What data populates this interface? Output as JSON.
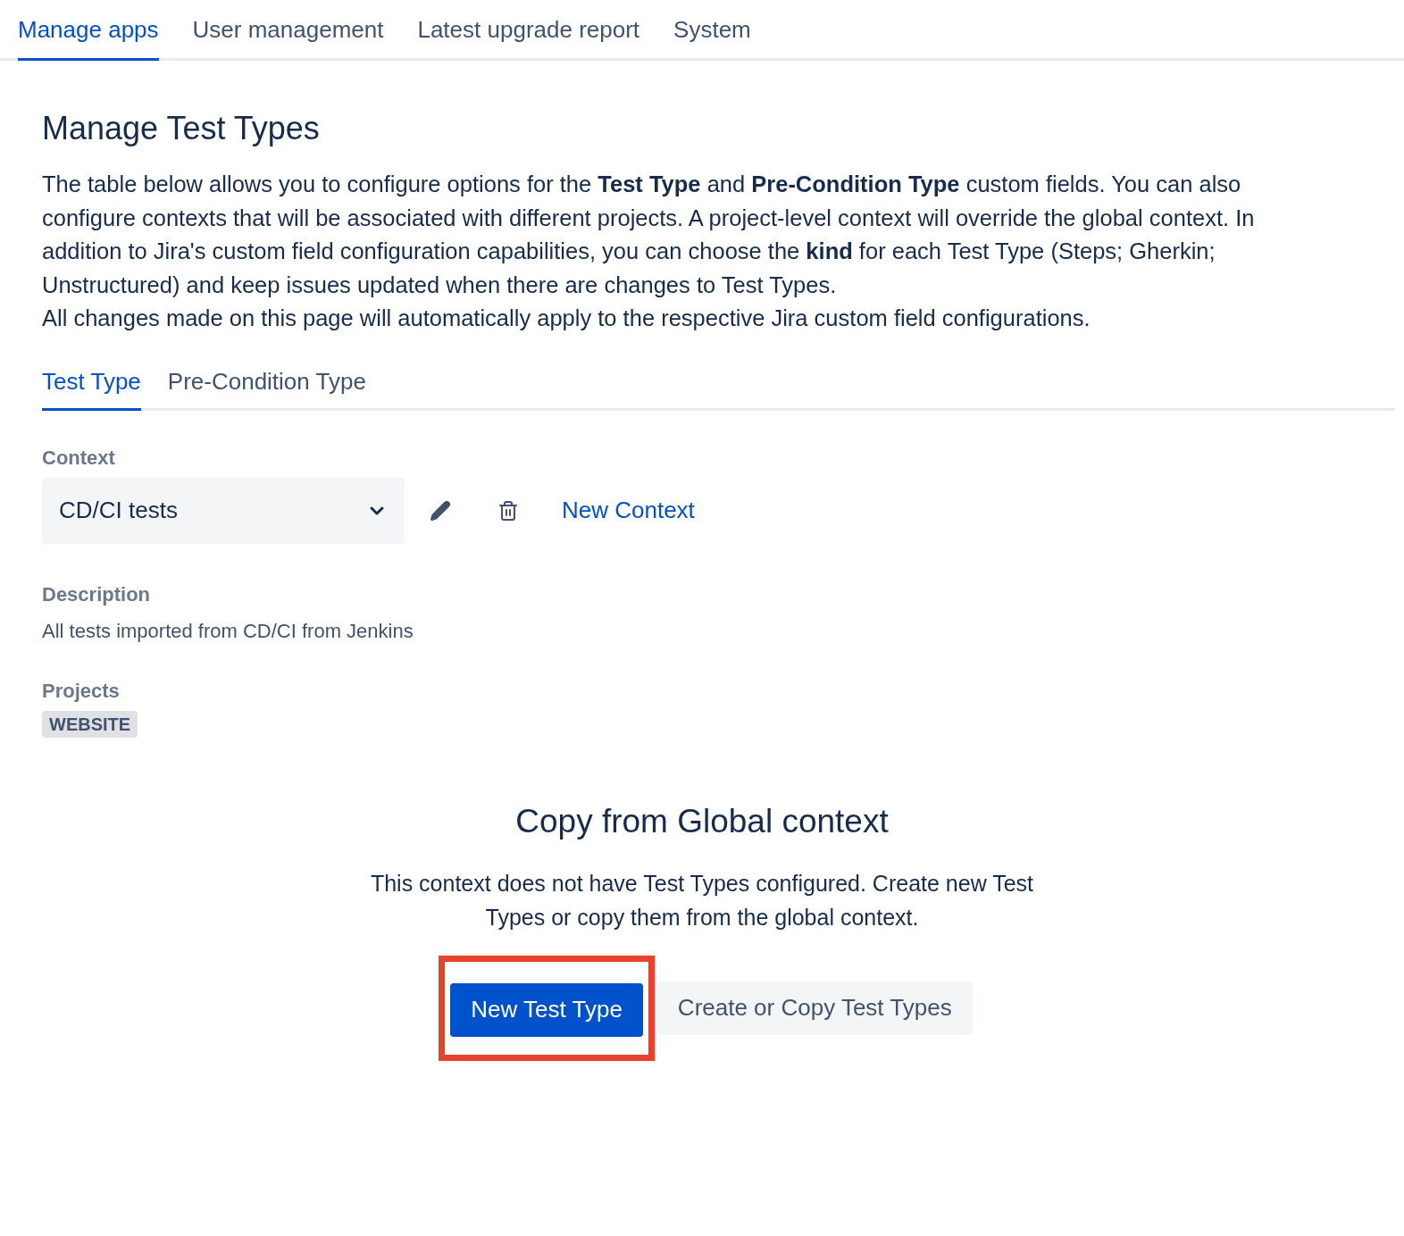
{
  "top_tabs": [
    {
      "label": "Manage apps",
      "selected": true
    },
    {
      "label": "User management",
      "selected": false
    },
    {
      "label": "Latest upgrade report",
      "selected": false
    },
    {
      "label": "System",
      "selected": false
    }
  ],
  "title": "Manage Test Types",
  "intro": [
    "The table below allows you to configure options for the **Test Type** and **Pre-Condition Type** custom fields. You can also configure contexts that will be associated with different projects. A project-level context will override the global context. In addition to Jira's custom field configuration capabilities, you can choose the **kind** for each Test Type (Steps; Gherkin; Unstructured) and keep issues updated when there are changes to Test Types.",
    "All changes made on this page will automatically apply to the respective Jira custom field configurations."
  ],
  "sub_tabs": [
    {
      "label": "Test Type",
      "selected": true
    },
    {
      "label": "Pre-Condition Type",
      "selected": false
    }
  ],
  "context": {
    "label": "Context",
    "value": "CD/CI tests",
    "new_link": "New Context"
  },
  "description": {
    "label": "Description",
    "text": "All tests imported from CD/CI from Jenkins"
  },
  "projects": {
    "label": "Projects",
    "tags": [
      "WEBSITE"
    ]
  },
  "empty_state": {
    "title": "Copy from Global context",
    "text": "This context does not have Test Types configured. Create new Test Types or copy them from the global context.",
    "buttons": [
      {
        "label": "New Test Type",
        "kind": "primary",
        "highlighted": true
      },
      {
        "label": "Create or Copy Test Types",
        "kind": "secondary",
        "highlighted": false
      }
    ]
  }
}
